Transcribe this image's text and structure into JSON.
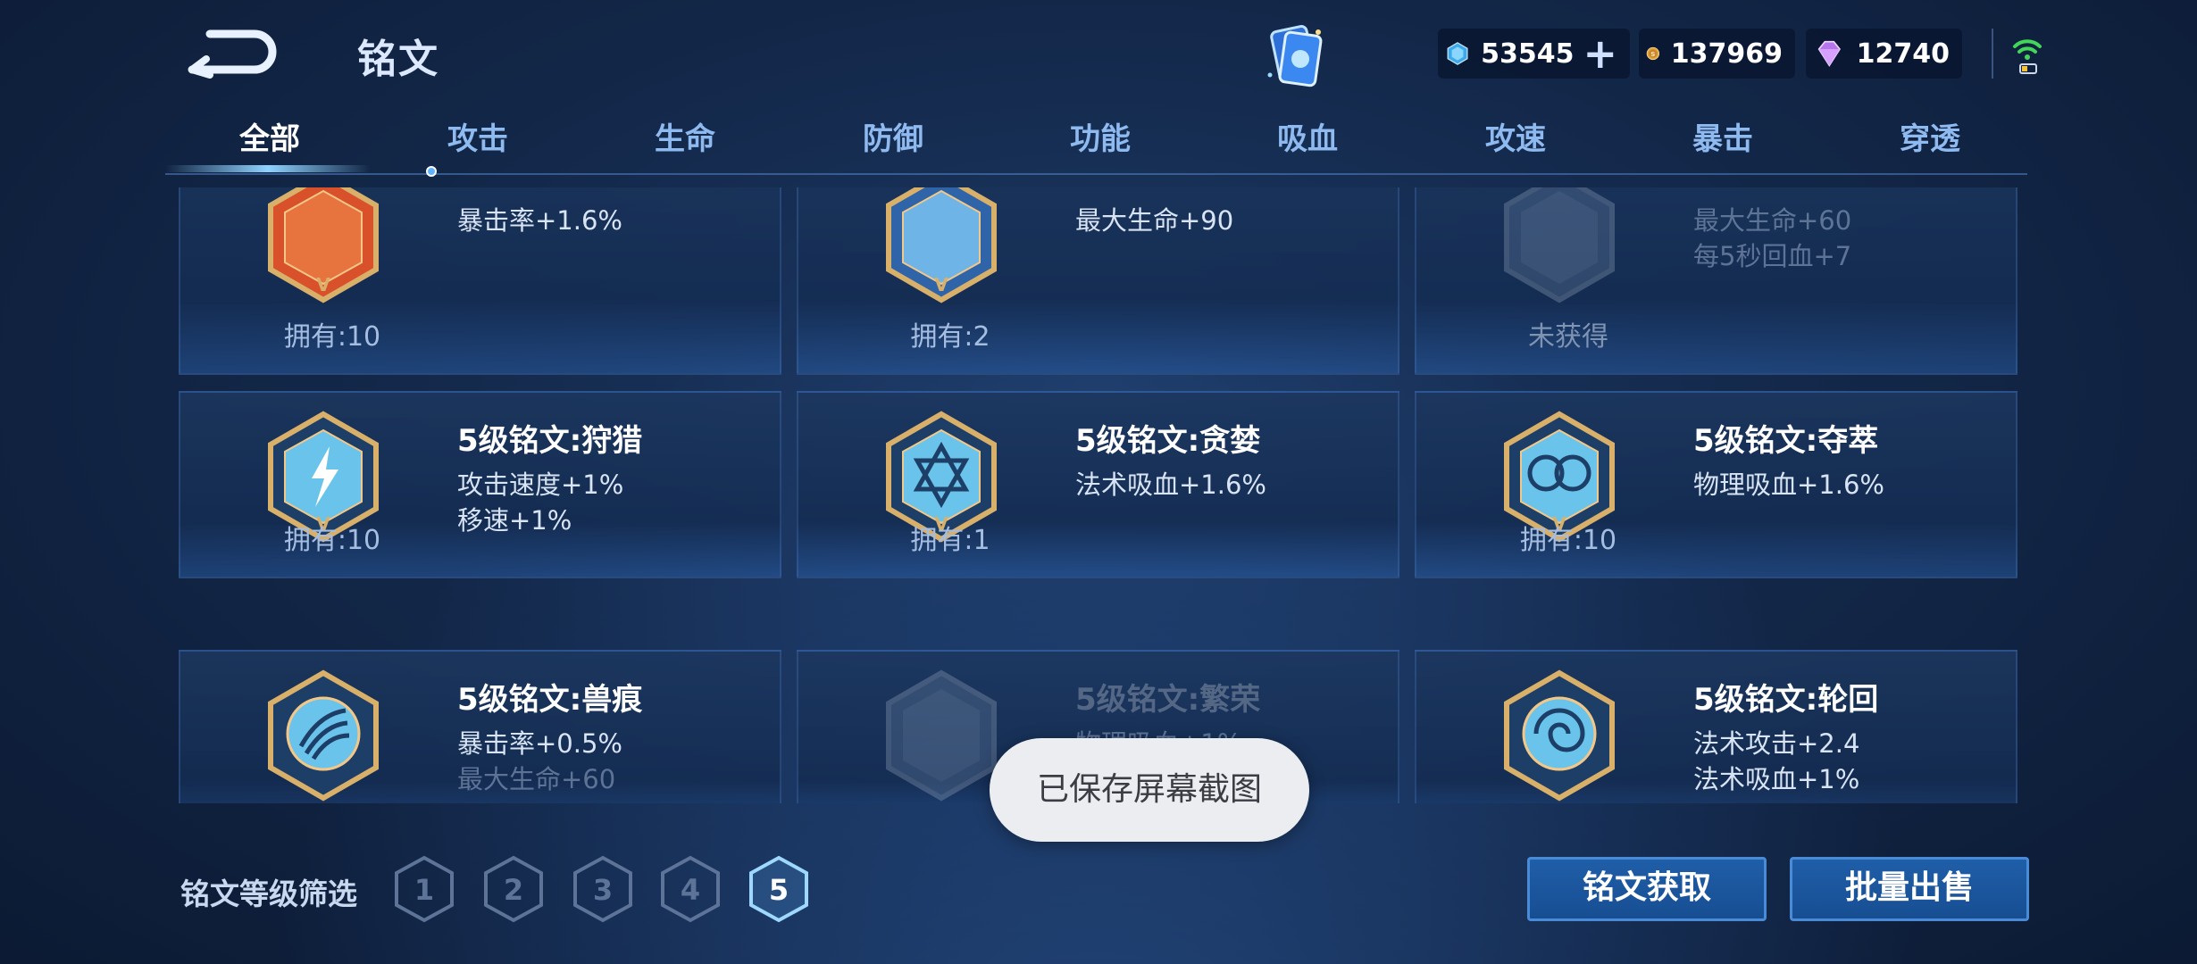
{
  "header": {
    "title": "铭文",
    "currencies": {
      "diamond": "53545",
      "gold": "137969",
      "gem": "12740"
    }
  },
  "tabs": [
    {
      "label": "全部",
      "active": true
    },
    {
      "label": "攻击"
    },
    {
      "label": "生命"
    },
    {
      "label": "防御"
    },
    {
      "label": "功能"
    },
    {
      "label": "吸血"
    },
    {
      "label": "攻速"
    },
    {
      "label": "暴击"
    },
    {
      "label": "穿透"
    }
  ],
  "runes": [
    {
      "name": "",
      "attrs": [
        "暴击率+1.6%"
      ],
      "owned": "拥有:10",
      "emblem_color": "#d8512a"
    },
    {
      "name": "",
      "attrs": [
        "最大生命+90"
      ],
      "owned": "拥有:2",
      "emblem_color": "#4d88c8"
    },
    {
      "name": "",
      "attrs": [
        "最大生命+60",
        "每5秒回血+7"
      ],
      "owned": "未获得",
      "emblem_color": "#6f87a8",
      "obtained": false
    },
    {
      "name": "5级铭文:狩猎",
      "attrs": [
        "攻击速度+1%",
        "移速+1%"
      ],
      "owned": "拥有:10",
      "emblem_color": "#69c3ea"
    },
    {
      "name": "5级铭文:贪婪",
      "attrs": [
        "法术吸血+1.6%"
      ],
      "owned": "拥有:1",
      "emblem_color": "#69c3ea"
    },
    {
      "name": "5级铭文:夺萃",
      "attrs": [
        "物理吸血+1.6%"
      ],
      "owned": "拥有:10",
      "emblem_color": "#69c3ea"
    },
    {
      "name": "5级铭文:兽痕",
      "attrs": [
        "暴击率+0.5%",
        "最大生命+60"
      ],
      "owned": "",
      "emblem_color": "#69c3ea"
    },
    {
      "name": "5级铭文:繁荣",
      "attrs": [
        "物理吸血+1%"
      ],
      "owned": "",
      "emblem_color": "#6f87a8",
      "obtained": false
    },
    {
      "name": "5级铭文:轮回",
      "attrs": [
        "法术攻击+2.4",
        "法术吸血+1%"
      ],
      "owned": "",
      "emblem_color": "#69c3ea"
    }
  ],
  "filter": {
    "label": "铭文等级筛选",
    "levels": [
      "1",
      "2",
      "3",
      "4",
      "5"
    ],
    "selected": "5"
  },
  "buttons": {
    "get": "铭文获取",
    "sell": "批量出售"
  },
  "toast": "已保存屏幕截图",
  "colors": {
    "accent": "#4a8bd8",
    "background": "#13284a",
    "active_level": "#9fd8ff"
  }
}
